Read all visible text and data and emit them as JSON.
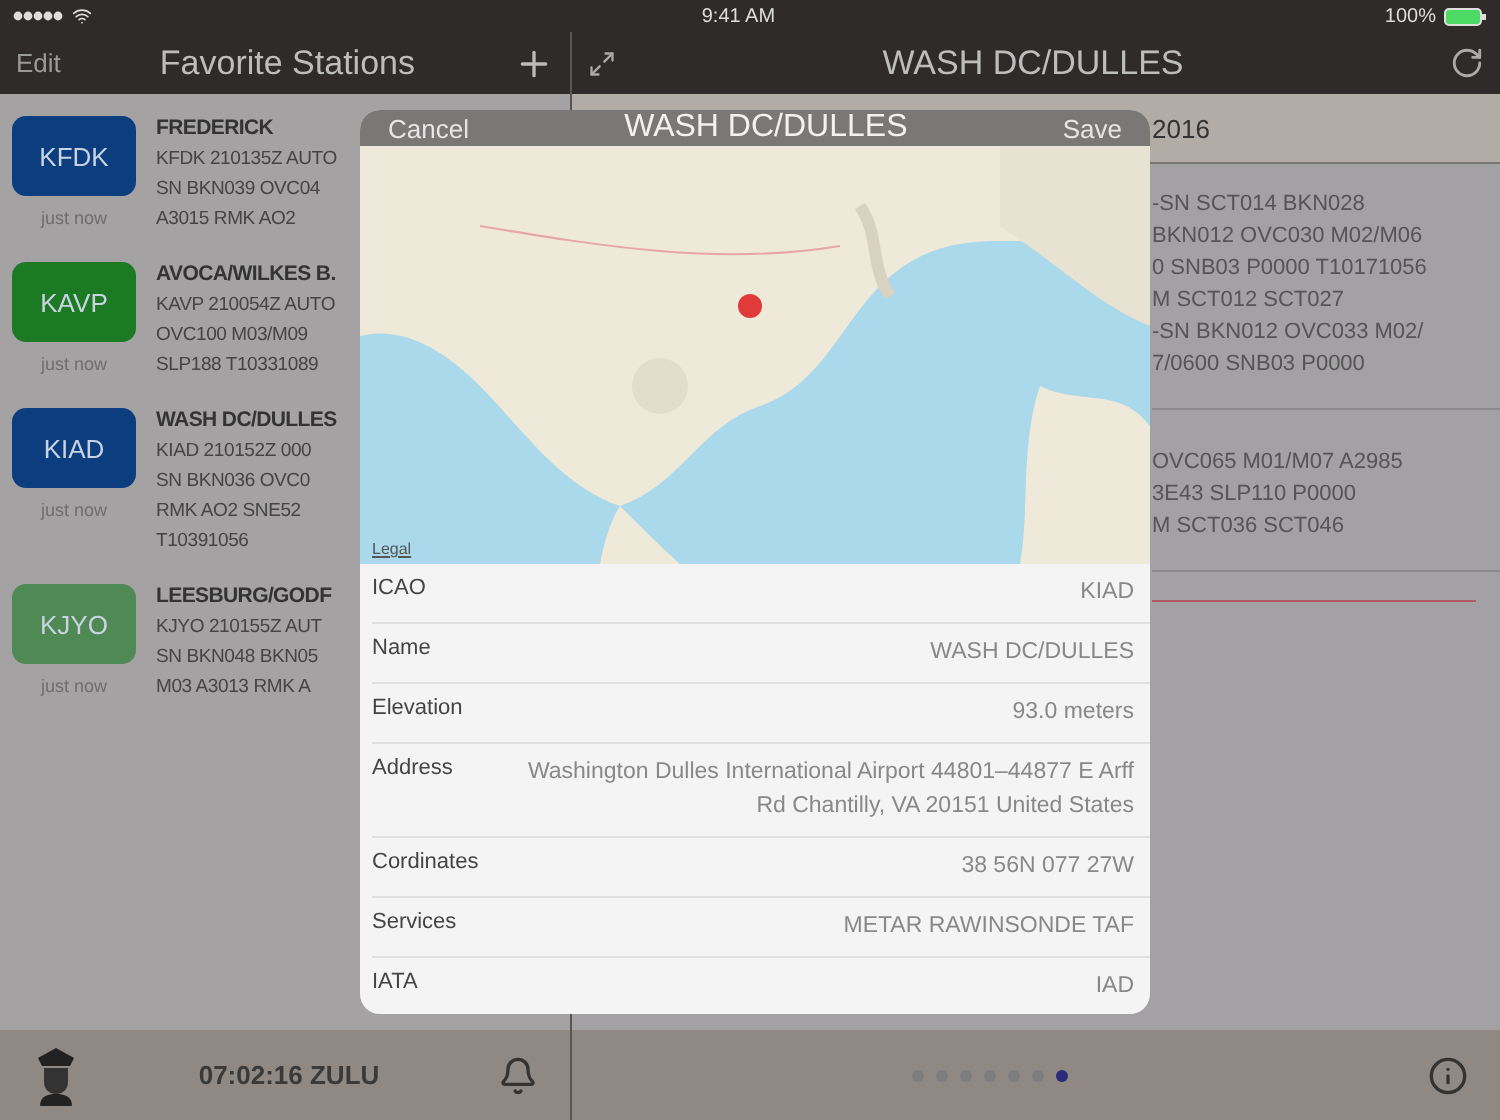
{
  "status_bar": {
    "time": "9:41 AM",
    "battery": "100%"
  },
  "sidebar": {
    "edit": "Edit",
    "title": "Favorite Stations",
    "stations": [
      {
        "code": "KFDK",
        "color": "#0c3d7e",
        "updated": "just now",
        "name": "FREDERICK",
        "metar": [
          "KFDK 210135Z AUTO",
          "SN BKN039 OVC04",
          "A3015 RMK AO2"
        ]
      },
      {
        "code": "KAVP",
        "color": "#1d7a24",
        "updated": "just now",
        "name": "AVOCA/WILKES B.",
        "metar": [
          "KAVP 210054Z AUTO",
          "OVC100 M03/M09",
          "SLP188 T10331089"
        ]
      },
      {
        "code": "KIAD",
        "color": "#0c3d7e",
        "updated": "just now",
        "name": "WASH DC/DULLES",
        "metar": [
          "KIAD 210152Z 000",
          "SN BKN036 OVC0",
          "RMK AO2 SNE52",
          "T10391056"
        ]
      },
      {
        "code": "KJYO",
        "color": "#4f8a55",
        "updated": "just now",
        "name": "LEESBURG/GODF",
        "metar": [
          "KJYO 210155Z AUT",
          "SN BKN048 BKN05",
          "M03 A3013 RMK A"
        ]
      }
    ],
    "clock": "07:02:16 ZULU"
  },
  "detail": {
    "title": "WASH DC/DULLES",
    "date": "2016",
    "reports": [
      [
        "-SN SCT014 BKN028",
        "BKN012 OVC030 M02/M06",
        "0 SNB03 P0000 T10171056",
        "M SCT012 SCT027",
        "-SN BKN012 OVC033 M02/",
        "7/0600 SNB03 P0000"
      ],
      [
        "OVC065 M01/M07 A2985",
        "3E43 SLP110 P0000",
        "M SCT036 SCT046"
      ]
    ],
    "pages": [
      {
        "selected": false
      },
      {
        "selected": false
      },
      {
        "selected": false
      },
      {
        "selected": false
      },
      {
        "selected": false
      },
      {
        "selected": false
      },
      {
        "selected": true
      }
    ]
  },
  "modal": {
    "cancel": "Cancel",
    "title": "WASH DC/DULLES",
    "save": "Save",
    "map_legal": "Legal",
    "fields": [
      {
        "label": "ICAO",
        "value": "KIAD"
      },
      {
        "label": "Name",
        "value": "WASH DC/DULLES"
      },
      {
        "label": "Elevation",
        "value": "93.0 meters"
      },
      {
        "label": "Address",
        "value": "Washington Dulles International Airport 44801–44877 E Arff Rd Chantilly, VA  20151 United States"
      },
      {
        "label": "Cordinates",
        "value": "38 56N  077 27W"
      },
      {
        "label": "Services",
        "value": "METAR RAWINSONDE TAF"
      },
      {
        "label": "IATA",
        "value": "IAD"
      }
    ]
  }
}
